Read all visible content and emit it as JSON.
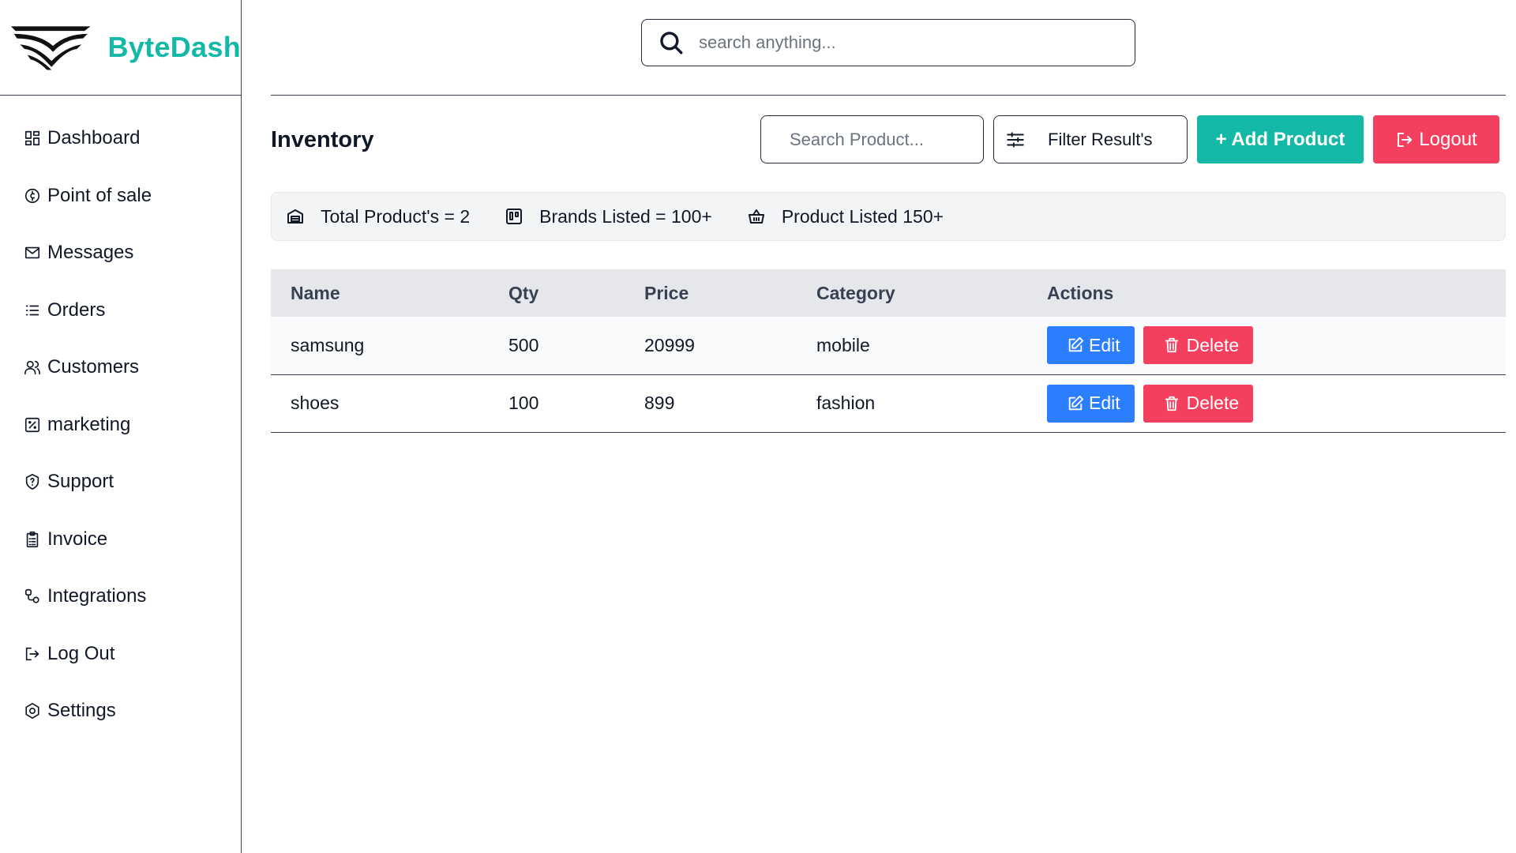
{
  "brand": {
    "name": "ByteDash"
  },
  "header": {
    "search_placeholder": "search anything..."
  },
  "sidebar": {
    "items": [
      {
        "label": "Dashboard",
        "icon": "dashboard-icon"
      },
      {
        "label": "Point of sale",
        "icon": "coin-icon"
      },
      {
        "label": "Messages",
        "icon": "mail-icon"
      },
      {
        "label": "Orders",
        "icon": "list-icon"
      },
      {
        "label": "Customers",
        "icon": "users-icon"
      },
      {
        "label": "marketing",
        "icon": "percent-icon"
      },
      {
        "label": "Support",
        "icon": "shield-icon"
      },
      {
        "label": "Invoice",
        "icon": "clipboard-icon"
      },
      {
        "label": "Integrations",
        "icon": "route-icon"
      },
      {
        "label": "Log Out",
        "icon": "logout-icon"
      },
      {
        "label": "Settings",
        "icon": "gear-icon"
      }
    ]
  },
  "main": {
    "title": "Inventory",
    "product_search_placeholder": "Search Product...",
    "filter_label": "Filter Result's",
    "add_label": "+ Add Product",
    "logout_label": "Logout",
    "stats": [
      {
        "label": "Total Product's = 2",
        "icon": "package-icon"
      },
      {
        "label": "Brands Listed = 100+",
        "icon": "board-icon"
      },
      {
        "label": "Product Listed 150+",
        "icon": "basket-icon"
      }
    ],
    "table": {
      "columns": [
        "Name",
        "Qty",
        "Price",
        "Category",
        "Actions"
      ],
      "rows": [
        {
          "name": "samsung",
          "qty": "500",
          "price": "20999",
          "category": "mobile"
        },
        {
          "name": "shoes",
          "qty": "100",
          "price": "899",
          "category": "fashion"
        }
      ],
      "edit_label": "Edit",
      "delete_label": "Delete"
    }
  },
  "colors": {
    "accent": "#14b8a6",
    "danger": "#f43f5e",
    "primary": "#2b7fff"
  }
}
